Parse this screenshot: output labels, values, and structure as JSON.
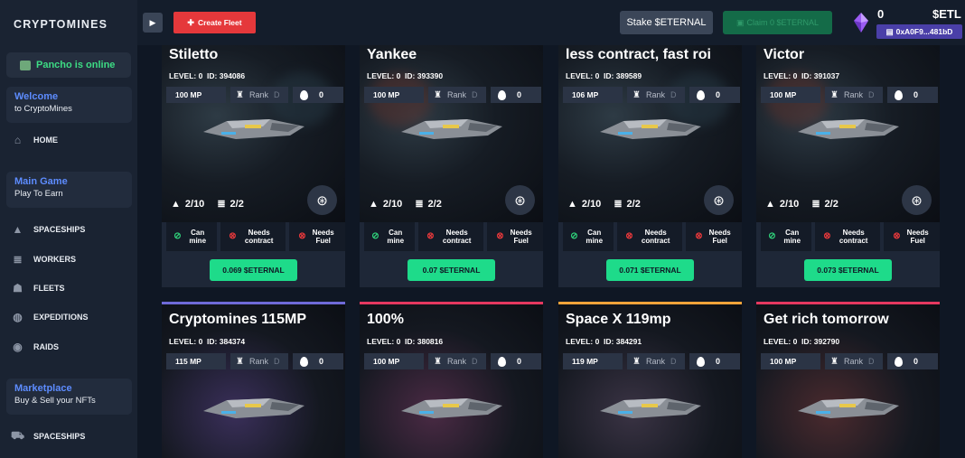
{
  "app": {
    "logo": "CRYPTOMINES"
  },
  "sidebar": {
    "online": "Pancho is online",
    "welcome": {
      "title": "Welcome",
      "subtitle": "to CryptoMines"
    },
    "home": "HOME",
    "main_game": {
      "title": "Main Game",
      "subtitle": "Play To Earn"
    },
    "items": [
      {
        "label": "SPACESHIPS",
        "icon": "rocket-icon"
      },
      {
        "label": "WORKERS",
        "icon": "layers-icon"
      },
      {
        "label": "FLEETS",
        "icon": "people-icon"
      },
      {
        "label": "EXPEDITIONS",
        "icon": "planet-icon"
      },
      {
        "label": "RAIDS",
        "icon": "target-icon"
      }
    ],
    "marketplace": {
      "title": "Marketplace",
      "subtitle": "Buy & Sell your NFTs"
    },
    "market_items": [
      {
        "label": "SPACESHIPS",
        "icon": "cart-icon"
      }
    ]
  },
  "topbar": {
    "create_fleet": "Create Fleet",
    "stake": "Stake  $ETERNAL",
    "claim": "Claim 0 $ETERNAL",
    "balance_eternal": "0",
    "balance_etl": "$ETL",
    "wallet": "0xA0F9...481bD"
  },
  "fleets": [
    {
      "name": "Stiletto",
      "level": "LEVEL: 0",
      "id": "ID: 394086",
      "mp": "100 MP",
      "rank": "Rank",
      "rank_value": "D",
      "fuel": "0",
      "workers": "2/10",
      "ships": "2/2",
      "can_mine": "Can mine",
      "needs_contract": "Needs contract",
      "needs_fuel": "Needs Fuel",
      "price": "0.069 $ETERNAL"
    },
    {
      "name": "Yankee",
      "level": "LEVEL: 0",
      "id": "ID: 393390",
      "mp": "100 MP",
      "rank": "Rank",
      "rank_value": "D",
      "fuel": "0",
      "workers": "2/10",
      "ships": "2/2",
      "can_mine": "Can mine",
      "needs_contract": "Needs contract",
      "needs_fuel": "Needs Fuel",
      "price": "0.07 $ETERNAL"
    },
    {
      "name": "less contract, fast roi",
      "level": "LEVEL: 0",
      "id": "ID: 389589",
      "mp": "106 MP",
      "rank": "Rank",
      "rank_value": "D",
      "fuel": "0",
      "workers": "2/10",
      "ships": "2/2",
      "can_mine": "Can mine",
      "needs_contract": "Needs contract",
      "needs_fuel": "Needs Fuel",
      "price": "0.071 $ETERNAL"
    },
    {
      "name": "Victor",
      "level": "LEVEL: 0",
      "id": "ID: 391037",
      "mp": "100 MP",
      "rank": "Rank",
      "rank_value": "D",
      "fuel": "0",
      "workers": "2/10",
      "ships": "2/2",
      "can_mine": "Can mine",
      "needs_contract": "Needs contract",
      "needs_fuel": "Needs Fuel",
      "price": "0.073 $ETERNAL"
    },
    {
      "name": "Cryptomines 115MP",
      "level": "LEVEL: 0",
      "id": "ID: 384374",
      "mp": "115 MP",
      "rank": "Rank",
      "rank_value": "D",
      "fuel": "0",
      "accent": "#6f6ad8"
    },
    {
      "name": "100%",
      "level": "LEVEL: 0",
      "id": "ID: 380816",
      "mp": "100 MP",
      "rank": "Rank",
      "rank_value": "D",
      "fuel": "0",
      "accent": "#e5385f"
    },
    {
      "name": "Space X 119mp",
      "level": "LEVEL: 0",
      "id": "ID: 384291",
      "mp": "119 MP",
      "rank": "Rank",
      "rank_value": "D",
      "fuel": "0",
      "accent": "#f2a33a"
    },
    {
      "name": "Get rich tomorrow",
      "level": "LEVEL: 0",
      "id": "ID: 392790",
      "mp": "100 MP",
      "rank": "Rank",
      "rank_value": "D",
      "fuel": "0",
      "accent": "#e5385f"
    }
  ],
  "colors": {
    "accent_green": "#1edb8a",
    "accent_red": "#e5383b",
    "link_blue": "#5d8cff",
    "online_green": "#3ddc84",
    "wallet_purple": "#4a3fa8"
  }
}
